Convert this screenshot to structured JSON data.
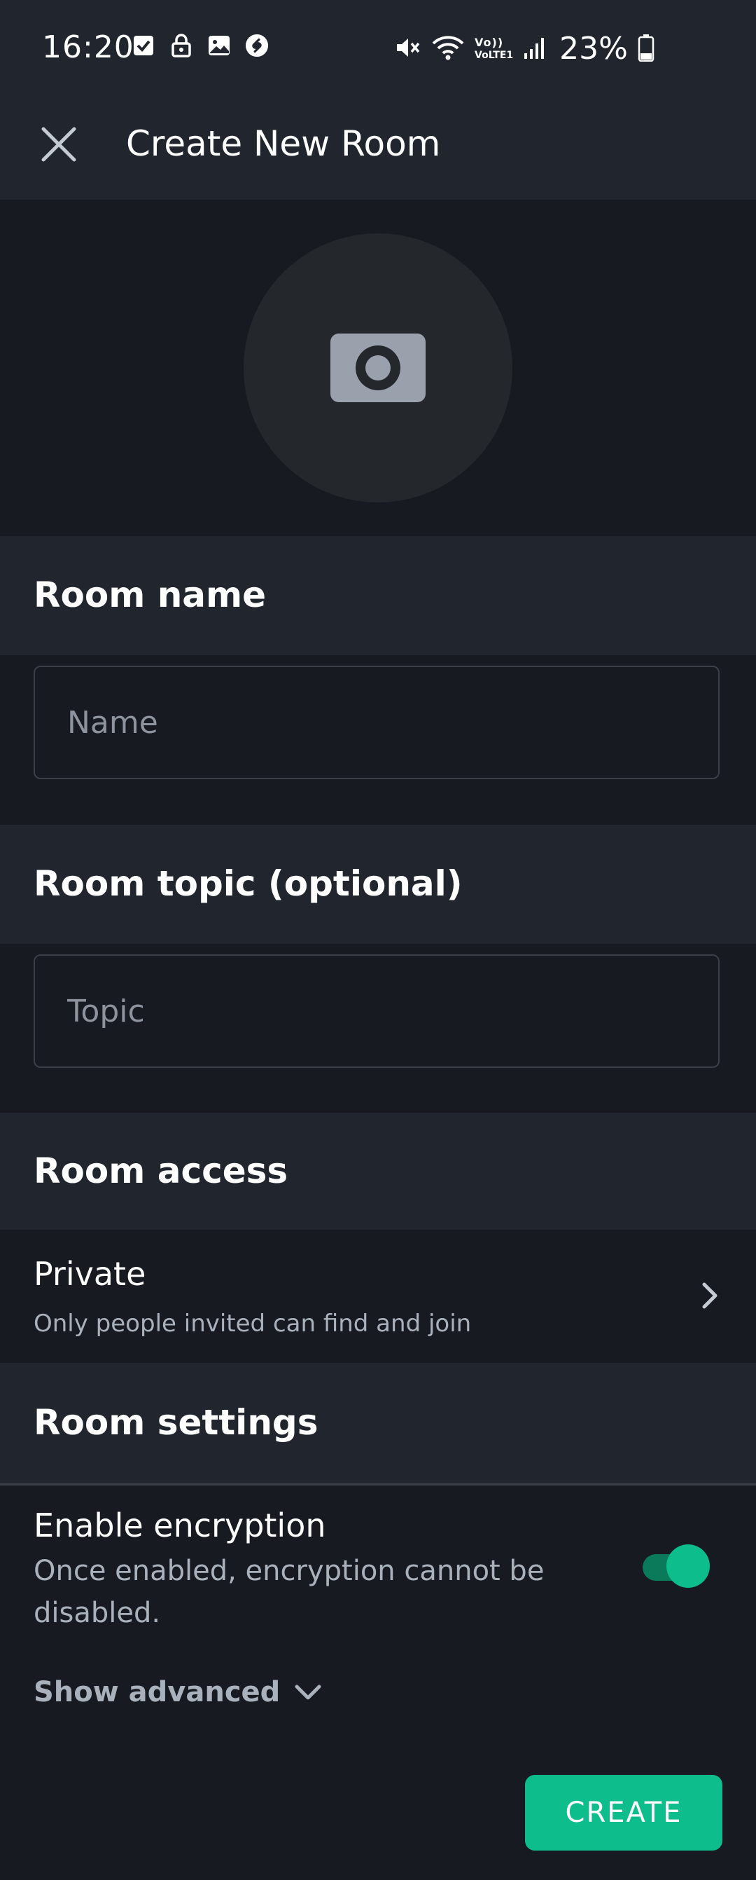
{
  "status_bar": {
    "time": "16:20",
    "battery": "23%",
    "network": "VoLTE1",
    "left_icons": [
      "check-icon",
      "lock-icon",
      "image-icon",
      "shazam-icon"
    ],
    "right_icons": [
      "mute-icon",
      "wifi-icon",
      "volte-icon",
      "signal-icon",
      "battery-icon"
    ]
  },
  "app_bar": {
    "title": "Create New Room",
    "close_icon": "close-icon"
  },
  "avatar": {
    "icon": "camera-icon"
  },
  "room_name": {
    "header": "Room name",
    "placeholder": "Name",
    "value": ""
  },
  "room_topic": {
    "header": "Room topic (optional)",
    "placeholder": "Topic",
    "value": ""
  },
  "room_access": {
    "header": "Room access",
    "title": "Private",
    "description": "Only people invited can find and join"
  },
  "room_settings": {
    "header": "Room settings",
    "encryption_title": "Enable encryption",
    "encryption_desc": "Once enabled, encryption cannot be disabled.",
    "encryption_enabled": true
  },
  "show_advanced": "Show advanced",
  "create_button": "CREATE",
  "colors": {
    "accent": "#0dbd8b",
    "background": "#171a21",
    "header_bg": "#21262e",
    "secondary_text": "#a9b2bc"
  }
}
